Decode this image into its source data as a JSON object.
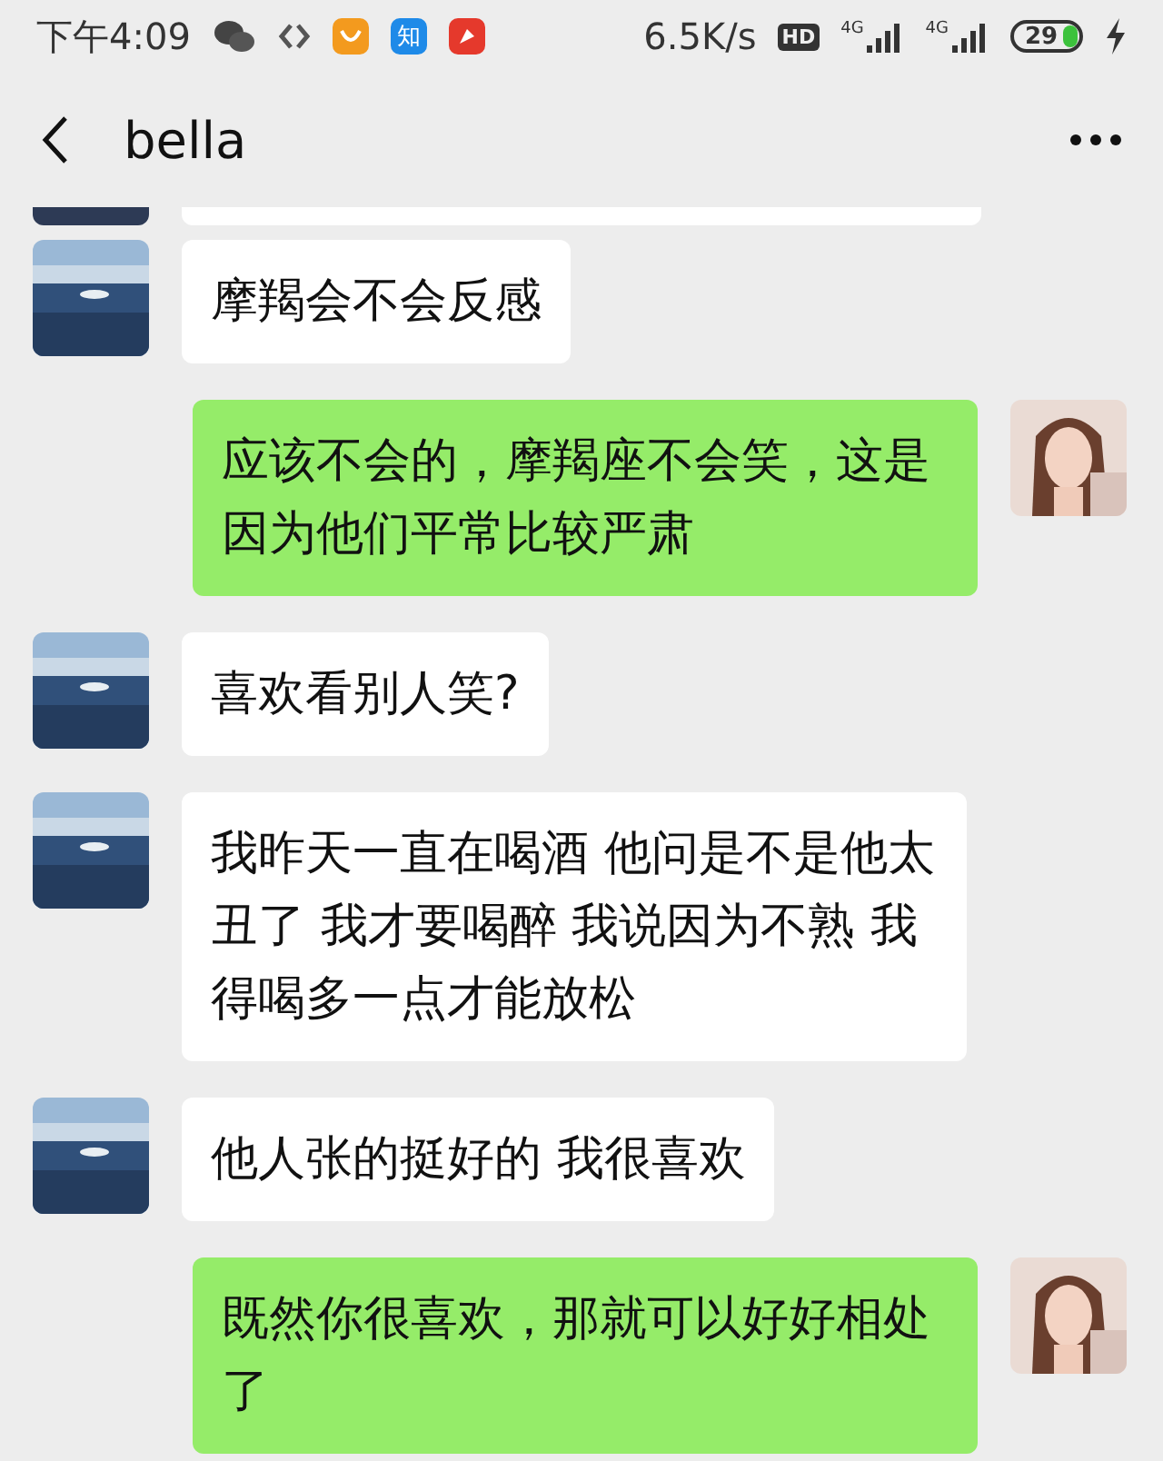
{
  "status_bar": {
    "time": "下午4:09",
    "app_icons": [
      {
        "kind": "wechat"
      },
      {
        "kind": "arrows"
      },
      {
        "kind": "smile",
        "color": "#f39a1e"
      },
      {
        "kind": "letter",
        "text": "知",
        "color": "#1e8ae8"
      },
      {
        "kind": "rocket",
        "color": "#e5392c"
      }
    ],
    "speed": "6.5K/s",
    "hd": "HD",
    "signals": [
      {
        "label": "4G"
      },
      {
        "label": "4G"
      }
    ],
    "battery": "29",
    "charging": true
  },
  "header": {
    "title": "bella"
  },
  "messages": [
    {
      "outgoing": false,
      "text": "摩羯会不会反感"
    },
    {
      "outgoing": true,
      "text": "应该不会的，摩羯座不会笑，这是因为他们平常比较严肃"
    },
    {
      "outgoing": false,
      "text": "喜欢看别人笑?"
    },
    {
      "outgoing": false,
      "text": "我昨天一直在喝酒 他问是不是他太丑了 我才要喝醉 我说因为不熟 我得喝多一点才能放松"
    },
    {
      "outgoing": false,
      "text": "他人张的挺好的 我很喜欢"
    },
    {
      "outgoing": true,
      "text": "既然你很喜欢，那就可以好好相处了"
    }
  ]
}
